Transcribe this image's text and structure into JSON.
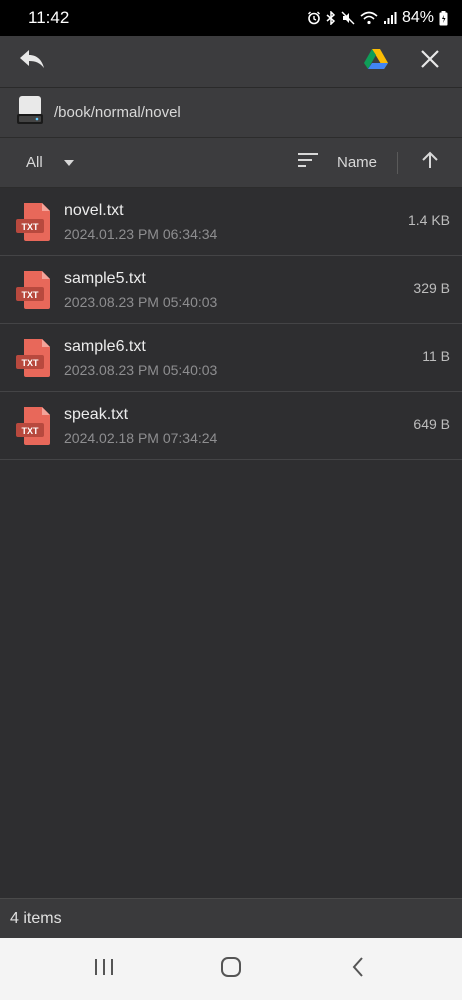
{
  "status_bar": {
    "time": "11:42",
    "battery": "84%"
  },
  "toolbar": {
    "back_icon": "reply-arrow-icon",
    "drive_icon": "google-drive-icon",
    "close_icon": "close-icon"
  },
  "path_bar": {
    "path": "/book/normal/novel",
    "icon": "storage-drive-icon"
  },
  "sort_bar": {
    "filter": "All",
    "sort_by": "Name"
  },
  "files": [
    {
      "name": "novel.txt",
      "date": "2024.01.23 PM 06:34:34",
      "size": "1.4 KB",
      "type": "TXT"
    },
    {
      "name": "sample5.txt",
      "date": "2023.08.23 PM 05:40:03",
      "size": "329 B",
      "type": "TXT"
    },
    {
      "name": "sample6.txt",
      "date": "2023.08.23 PM 05:40:03",
      "size": "11 B",
      "type": "TXT"
    },
    {
      "name": "speak.txt",
      "date": "2024.02.18 PM 07:34:24",
      "size": "649 B",
      "type": "TXT"
    }
  ],
  "footer": {
    "count": "4 items"
  },
  "colors": {
    "background": "#2e2e30",
    "toolbar": "#3c3c3e",
    "txt_icon": "#e8685a",
    "nav_bar": "#f4f4f4"
  }
}
